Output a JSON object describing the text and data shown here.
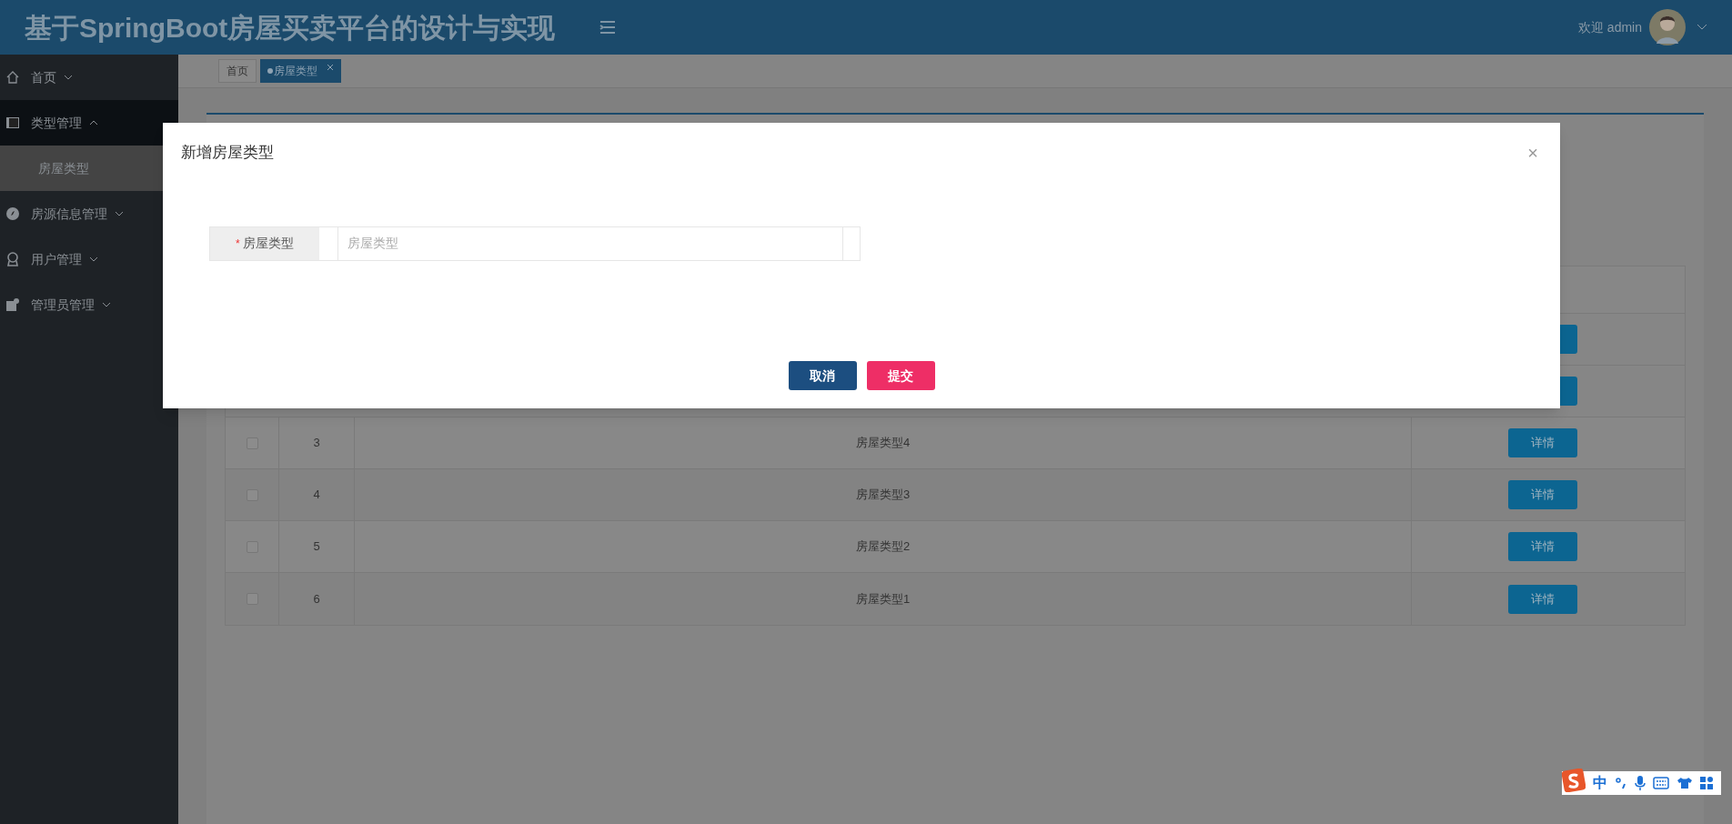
{
  "header": {
    "title": "基于SpringBoot房屋买卖平台的设计与实现",
    "welcome": "欢迎 admin"
  },
  "sidebar": {
    "items": [
      {
        "label": "首页",
        "expanded": false,
        "selected": false
      },
      {
        "label": "类型管理",
        "expanded": true,
        "selected": true,
        "children": [
          {
            "label": "房屋类型",
            "selected": true
          }
        ]
      },
      {
        "label": "房源信息管理",
        "expanded": false,
        "selected": false
      },
      {
        "label": "用户管理",
        "expanded": false,
        "selected": false
      },
      {
        "label": "管理员管理",
        "expanded": false,
        "selected": false
      }
    ]
  },
  "tabs": [
    {
      "label": "首页",
      "selected": false,
      "closable": false
    },
    {
      "label": "房屋类型",
      "selected": true,
      "closable": true
    }
  ],
  "table": {
    "rows": [
      {
        "index": "3",
        "name": "房屋类型4",
        "checked": false,
        "action": "详情"
      },
      {
        "index": "4",
        "name": "房屋类型3",
        "checked": false,
        "action": "详情"
      },
      {
        "index": "5",
        "name": "房屋类型2",
        "checked": false,
        "action": "详情"
      },
      {
        "index": "6",
        "name": "房屋类型1",
        "checked": false,
        "action": "详情"
      }
    ]
  },
  "dialog": {
    "title": "新增房屋类型",
    "close": "×",
    "fields": [
      {
        "label": "房屋类型",
        "required_mark": "*",
        "placeholder": "房屋类型"
      }
    ],
    "buttons": [
      {
        "label": "取消",
        "kind": "cancel"
      },
      {
        "label": "提交",
        "kind": "submit"
      }
    ]
  },
  "ime_toolbar": {
    "mode": "中"
  }
}
